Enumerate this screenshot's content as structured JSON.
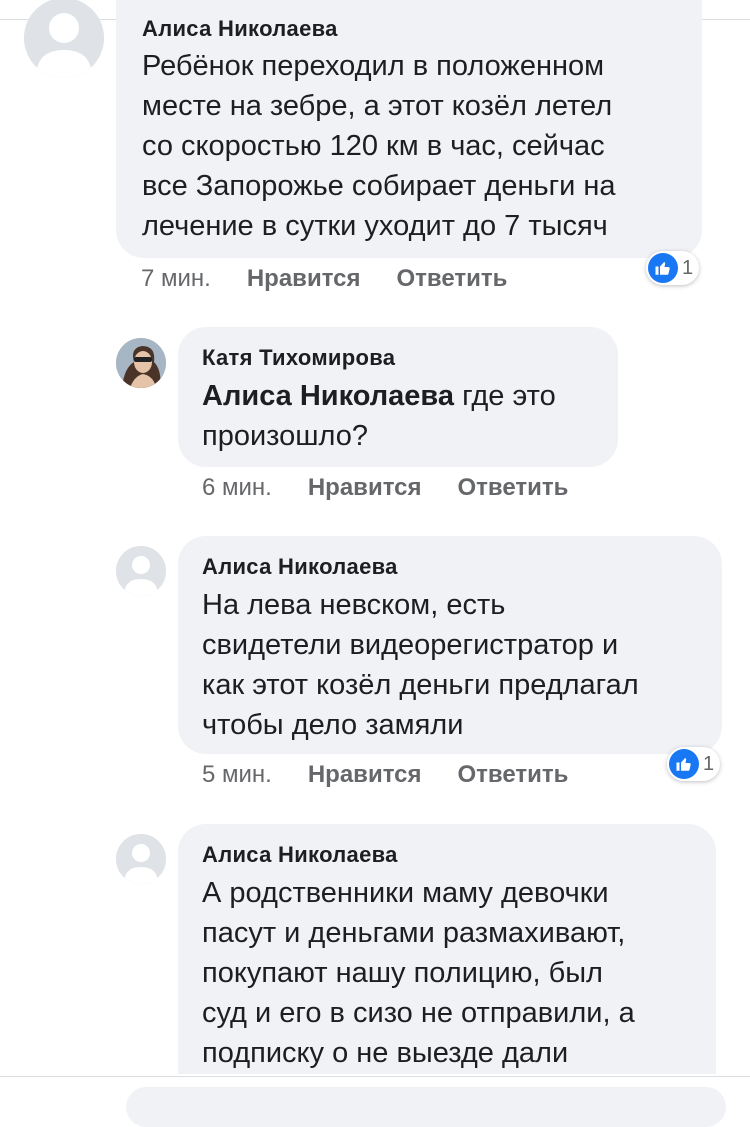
{
  "colors": {
    "accent": "#1877f2",
    "bubble": "#f0f2f5",
    "meta": "#65676b"
  },
  "comments": [
    {
      "author": "Алиса Николаева",
      "lines": [
        "Ребёнок переходил в положенном",
        "месте на зебре, а этот козёл летел",
        "со скоростью 120 км в час, сейчас",
        "все Запорожье собирает деньги на",
        "лечение в сутки уходит до 7 тысяч"
      ],
      "time": "7 мин.",
      "like_label": "Нравится",
      "reply_label": "Ответить",
      "reaction_icon": "like-icon",
      "reaction_count": "1"
    },
    {
      "author": "Катя Тихомирова",
      "mention": "Алиса Николаева",
      "lines": [
        " где это",
        "произошло?"
      ],
      "time": "6 мин.",
      "like_label": "Нравится",
      "reply_label": "Ответить"
    },
    {
      "author": "Алиса Николаева",
      "lines": [
        "На лева невском, есть",
        "свидетели видеорегистратор и",
        "как этот козёл деньги предлагал",
        "чтобы дело замяли"
      ],
      "time": "5 мин.",
      "like_label": "Нравится",
      "reply_label": "Ответить",
      "reaction_icon": "like-icon",
      "reaction_count": "1"
    },
    {
      "author": "Алиса Николаева",
      "lines": [
        "А родственники маму девочки",
        "пасут и деньгами размахивают,",
        "покупают нашу полицию, был",
        "суд и его в сизо не отправили, а",
        "подписку о не выезде дали"
      ]
    }
  ]
}
